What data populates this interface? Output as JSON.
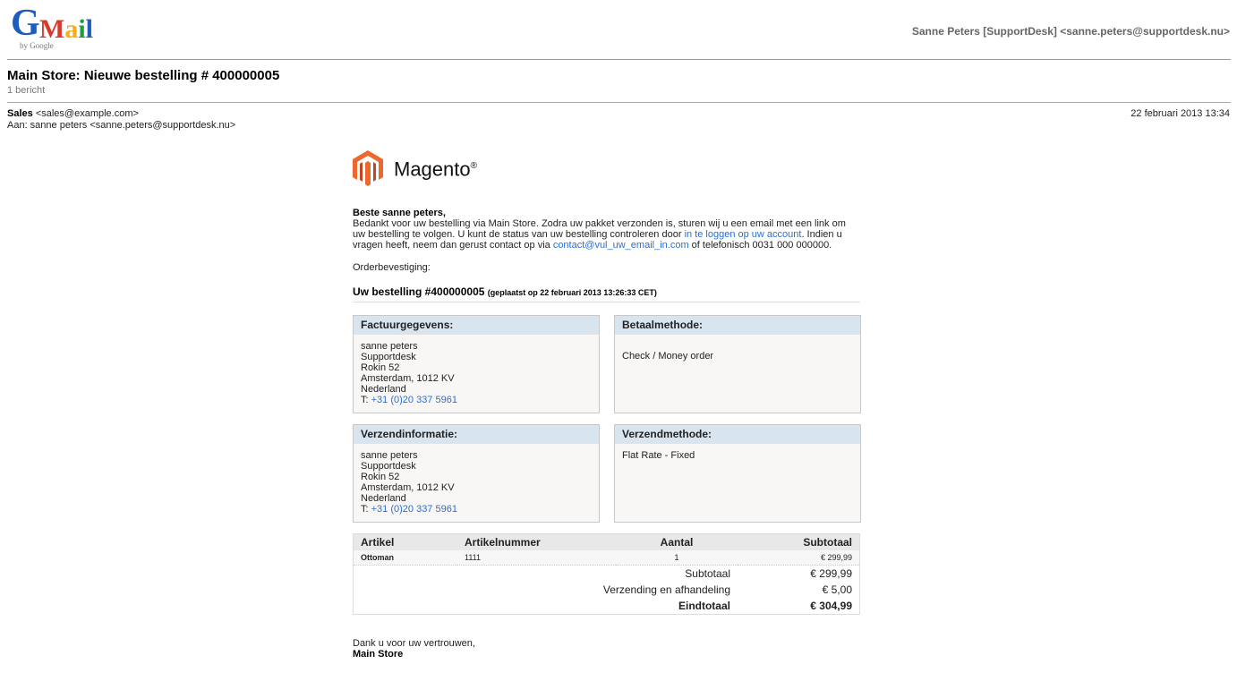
{
  "header": {
    "logo_text": "Gmail",
    "logo_sub": "by Google",
    "account": "Sanne Peters [SupportDesk] <sanne.peters@supportdesk.nu>"
  },
  "thread": {
    "subject": "Main Store: Nieuwe bestelling # 400000005",
    "count": "1 bericht"
  },
  "message": {
    "from_name": "Sales",
    "from_email": "<sales@example.com>",
    "to": "Aan: sanne peters <sanne.peters@supportdesk.nu>",
    "date": "22 februari 2013 13:34"
  },
  "email": {
    "brand": "Magento",
    "brand_mark": "®",
    "greeting": "Beste sanne peters,",
    "body_1": "Bedankt voor uw bestelling via Main Store. Zodra uw pakket verzonden is, sturen wij u een email met een link om uw bestelling te volgen. U kunt de status van uw bestelling controleren door ",
    "login_link": "in te loggen op uw account",
    "body_2": ". Indien u vragen heeft, neem dan gerust contact op via ",
    "email_link": "contact@vul_uw_email_in.com",
    "body_3": " of telefonisch 0031 000 000000.",
    "order_conf": "Orderbevestiging:",
    "order_title": "Uw bestelling #400000005",
    "order_placed": "(geplaatst op 22 februari 2013 13:26:33 CET)",
    "billing": {
      "title": "Factuurgegevens:",
      "lines": [
        "sanne peters",
        "Supportdesk",
        "Rokin 52",
        "Amsterdam, 1012 KV",
        "Nederland"
      ],
      "phone_prefix": "T: ",
      "phone": "+31 (0)20 337 5961"
    },
    "payment": {
      "title": "Betaalmethode:",
      "value": "Check / Money order"
    },
    "shipping": {
      "title": "Verzendinformatie:",
      "lines": [
        "sanne peters",
        "Supportdesk",
        "Rokin 52",
        "Amsterdam, 1012 KV",
        "Nederland"
      ],
      "phone_prefix": "T: ",
      "phone": "+31 (0)20 337 5961"
    },
    "shipping_method": {
      "title": "Verzendmethode:",
      "value": "Flat Rate - Fixed"
    },
    "items": {
      "headers": [
        "Artikel",
        "Artikelnummer",
        "Aantal",
        "Subtotaal"
      ],
      "rows": [
        {
          "name": "Ottoman",
          "sku": "1111",
          "qty": "1",
          "subtotal": "€ 299,99"
        }
      ],
      "totals": [
        {
          "label": "Subtotaal",
          "value": "€ 299,99"
        },
        {
          "label": "Verzending en afhandeling",
          "value": "€ 5,00"
        },
        {
          "label": "Eindtotaal",
          "value": "€ 304,99"
        }
      ]
    },
    "closing": "Dank u voor uw vertrouwen,",
    "store": "Main Store"
  },
  "colors": {
    "link": "#2a6fd6",
    "box_header": "#d9e5ee",
    "magento_orange": "#ee672f"
  }
}
